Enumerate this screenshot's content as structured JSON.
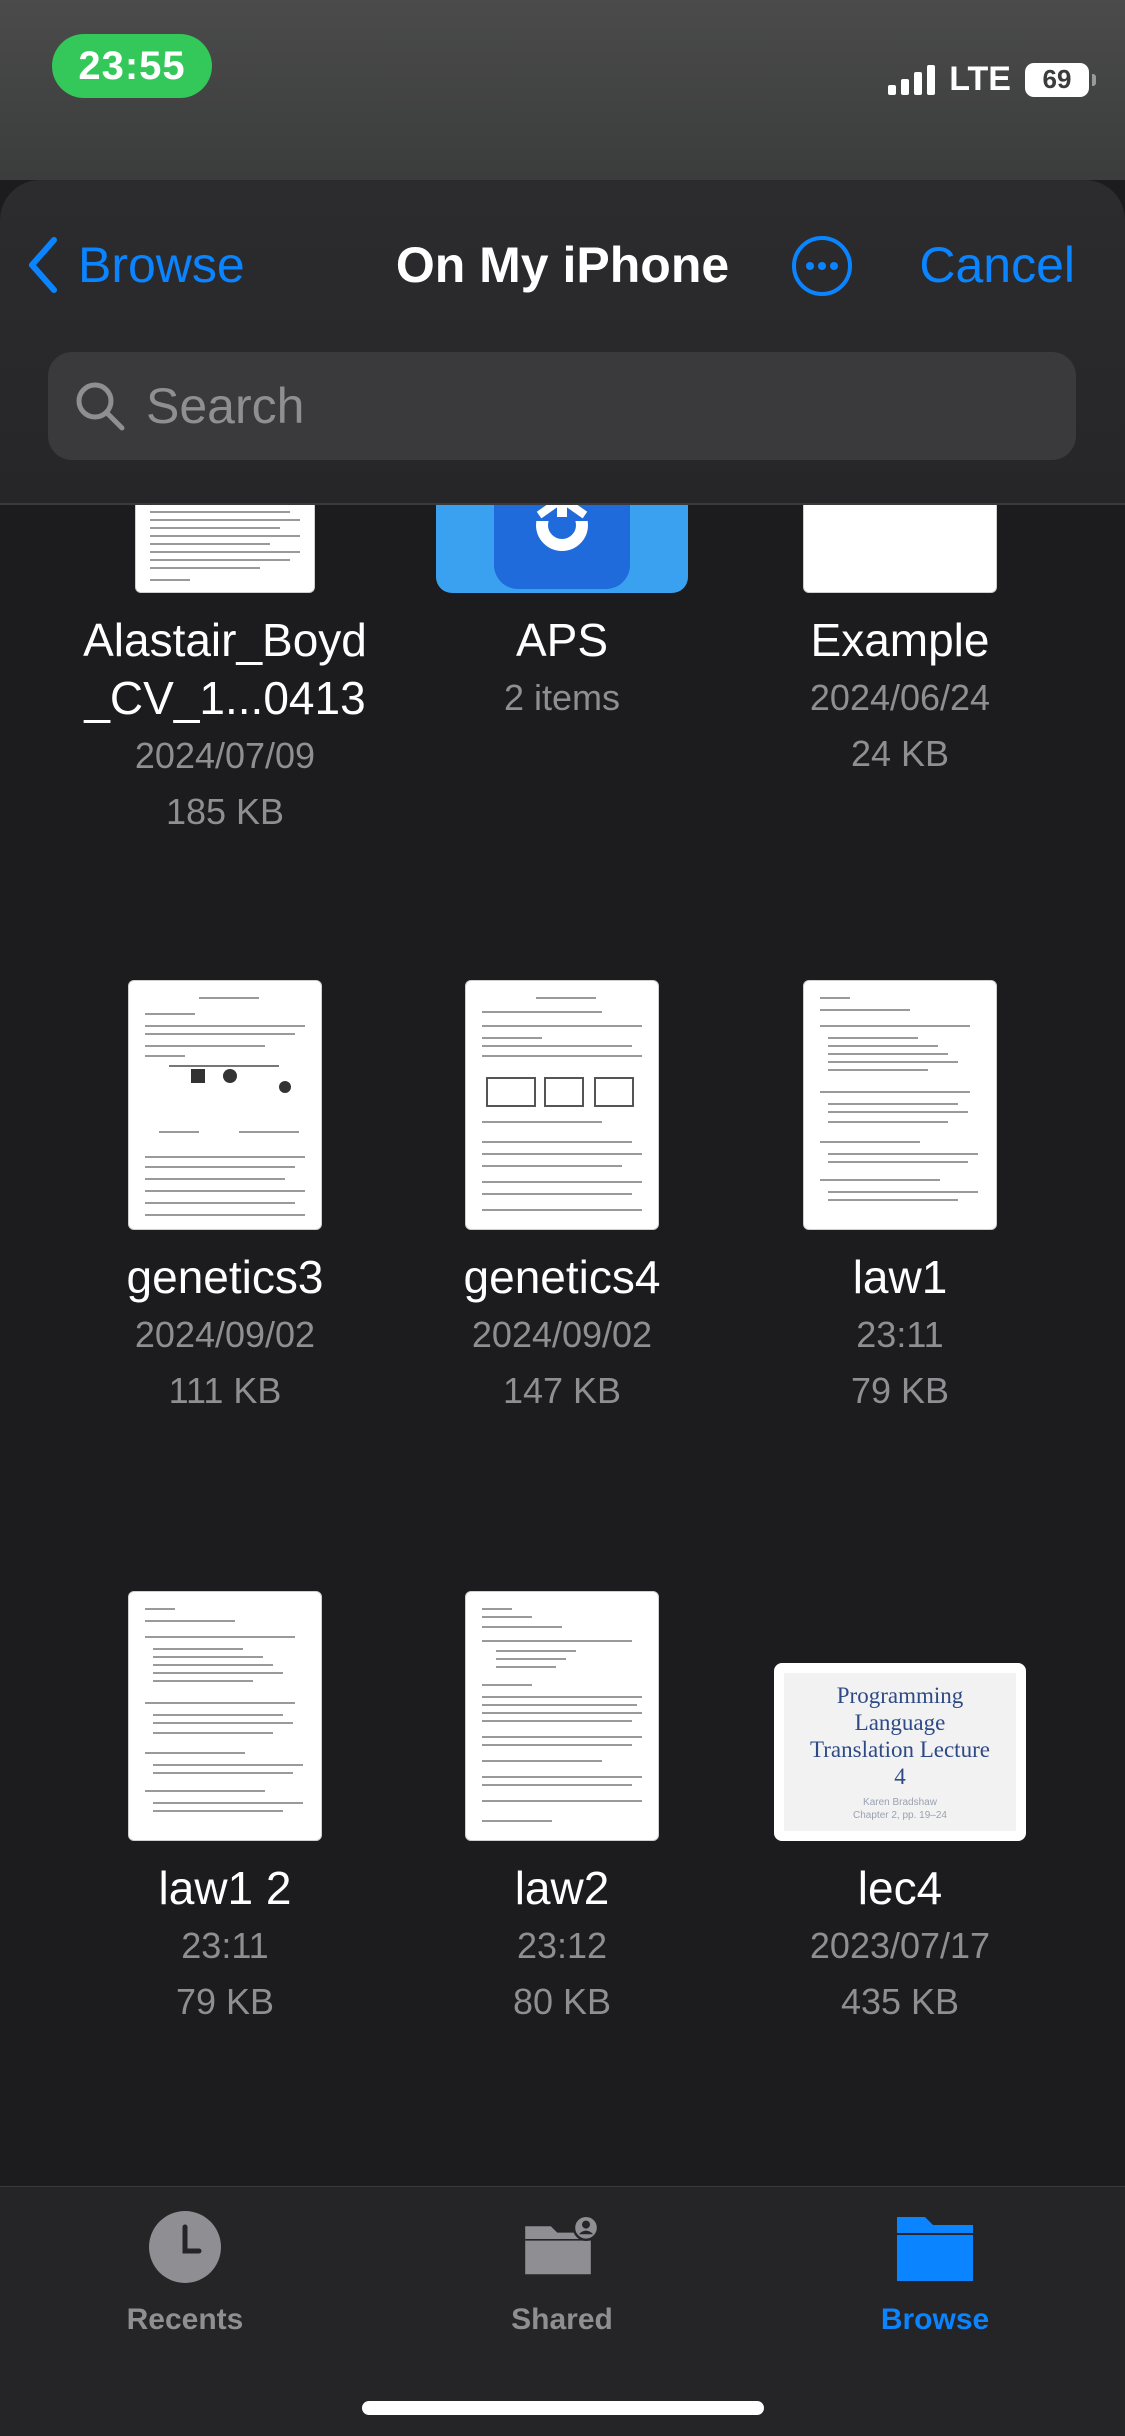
{
  "status": {
    "time": "23:55",
    "network": "LTE",
    "battery": "69"
  },
  "nav": {
    "back_label": "Browse",
    "title": "On My iPhone",
    "cancel_label": "Cancel"
  },
  "search": {
    "placeholder": "Search"
  },
  "files": [
    {
      "name_lines": [
        "Alastair_Boyd",
        "_CV_1...0413"
      ],
      "line1": "2024/07/09",
      "line2": "185 KB",
      "thumb": "document"
    },
    {
      "name_lines": [
        "APS"
      ],
      "line1": "2 items",
      "line2": "",
      "thumb": "folder"
    },
    {
      "name_lines": [
        "Example"
      ],
      "line1": "2024/06/24",
      "line2": "24 KB",
      "thumb": "blank-document"
    },
    {
      "name_lines": [
        "genetics3"
      ],
      "line1": "2024/09/02",
      "line2": "111 KB",
      "thumb": "document"
    },
    {
      "name_lines": [
        "genetics4"
      ],
      "line1": "2024/09/02",
      "line2": "147 KB",
      "thumb": "document"
    },
    {
      "name_lines": [
        "law1"
      ],
      "line1": "23:11",
      "line2": "79 KB",
      "thumb": "document"
    },
    {
      "name_lines": [
        "law1 2"
      ],
      "line1": "23:11",
      "line2": "79 KB",
      "thumb": "document"
    },
    {
      "name_lines": [
        "law2"
      ],
      "line1": "23:12",
      "line2": "80 KB",
      "thumb": "document"
    },
    {
      "name_lines": [
        "lec4"
      ],
      "line1": "2023/07/17",
      "line2": "435 KB",
      "thumb": "slide"
    }
  ],
  "lec4_slide": {
    "title": "Programming Language Translation Lecture 4",
    "subtitle": "Karen Bradshaw\nChapter 2, pp. 19–24"
  },
  "tabs": [
    {
      "label": "Recents",
      "icon": "clock-icon",
      "active": false
    },
    {
      "label": "Shared",
      "icon": "shared-folder-icon",
      "active": false
    },
    {
      "label": "Browse",
      "icon": "folder-icon",
      "active": true
    }
  ],
  "colors": {
    "accent": "#0a84ff",
    "status_pill": "#34c759",
    "background": "#1c1c1e",
    "secondary_text": "#8e8e93"
  }
}
